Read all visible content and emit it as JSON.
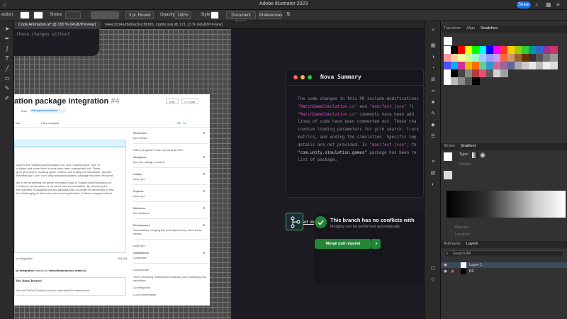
{
  "app": {
    "title": "Adobe Illustrator 2023",
    "share_label": "Share"
  },
  "control_bar": {
    "left_label": "ection",
    "stroke_label": "Stroke",
    "brush_label": "3 pt. Round",
    "opacity_label": "Opacity",
    "opacity_value": "100%",
    "style_label": "Style",
    "doc_setup": "Document Setup",
    "preferences": "Preferences"
  },
  "doc_tabs": [
    {
      "label": "Code Animation.ai* @ 150 % (RGB/Preview)"
    },
    {
      "label": "64ee3154ad6d6ad1ecf93db_Lights.svg @ 171.13 % (RGB/Preview)"
    }
  ],
  "canvas": {
    "code_snippet": "these changes without",
    "github": {
      "title_main": "ation package integration",
      "title_num": "#4",
      "from_text": "from",
      "branch_pill": "stdio/gamesimulation",
      "edit_label": "Edit",
      "code_label": "<> Code",
      "tabs": [
        "nits",
        "Files changed"
      ],
      "diffstat": "+36 −14",
      "desc_lines": [
        "nges to the \"MatchGameSimulation.cs\" and \"manifest.json\" files. In",
        "n added and some lines of code have been commented out. These",
        "g for grid search, tracking game metrics, and ending the simulation. Specific",
        "manifest.json\", the \"com.unity.simulation.games\" package has been removed",
        "",
        "ars to be an altering the game simulation logic in \"MatchGameSimulation.cs\"",
        "r enhance performance or introduce new functionalities. By removing the",
        "the manifest, it suggests that the package may no longer be necessary or has",
        "it is challenging to determine the exact implications of these changes without"
      ],
      "commit_line": "se-integration",
      "commit_hash": "f1f1c18",
      "branch_line_pre": "se-integration",
      "branch_line_mid": "branch on",
      "branch_line_target": "slimz/dotdemonico-match-a",
      "base_branch": "the base branch",
      "cli_hint": "line via GitHub Desktop or view command line instructions.",
      "sidebar": [
        {
          "label": "Reviewers",
          "value": "No reviews"
        },
        {
          "label": "",
          "value": "Still in progress? Learn about draft PRs"
        },
        {
          "label": "Assignees",
          "value": "No one—assign yourself"
        },
        {
          "label": "Labels",
          "value": "None yet"
        },
        {
          "label": "Projects",
          "value": "None yet"
        },
        {
          "label": "Milestone",
          "value": "No milestone"
        },
        {
          "label": "Development",
          "value": "Successfully merging this pull request may close these issues."
        },
        {
          "label": "",
          "value": "None yet"
        },
        {
          "label": "Notifications",
          "value": "Customize"
        },
        {
          "label": "",
          "value": "Unsubscribe"
        },
        {
          "label": "",
          "value": "You're receiving notifications because you're watching this repository."
        },
        {
          "label": "",
          "value": "2 participants"
        },
        {
          "label": "",
          "value": "Lock conversation"
        }
      ]
    },
    "nova": {
      "title": "Nova Summary",
      "lines": [
        [
          {
            "t": "The code changes in this PR include modifications"
          }
        ],
        [
          {
            "t": "\"MatchGameSimulation.cs\"",
            "c": "pk"
          },
          {
            "t": " and "
          },
          {
            "t": "\"manifest.json\"",
            "c": "pk"
          },
          {
            "t": " fi"
          }
        ],
        [
          {
            "t": "\"MatchGameSimulation.cs\"",
            "c": "pk"
          },
          {
            "t": " comments have been add"
          }
        ],
        [
          {
            "t": "lines of code have been commented out. These cha"
          }
        ],
        [
          {
            "t": "involve loading parameters for grid search, track"
          }
        ],
        [
          {
            "t": "metrics, and ending the simulation. Specific imp"
          }
        ],
        [
          {
            "t": "details are not provided. In "
          },
          {
            "t": "\"manifest.json\"",
            "c": "pk"
          },
          {
            "t": ", th"
          }
        ],
        [
          {
            "t": "\"com.unity.simulation.games\"",
            "c": "wh"
          },
          {
            "t": " package has been re"
          }
        ],
        [
          {
            "t": "list of package."
          }
        ]
      ],
      "load_more": "load more"
    },
    "merge": {
      "title": "This branch has no conflicts with",
      "subtitle": "Merging can be performed automatically.",
      "button": "Merge pull request"
    }
  },
  "panels": {
    "top_tabs": [
      "Transform",
      "Align",
      "Swatches"
    ],
    "mid_tabs": [
      "Stroke",
      "Gradient"
    ],
    "gradient_type_label": "Type:",
    "stroke_label": "Stroke:",
    "opacity_label": "Opacity:",
    "location_label": "Location:",
    "bottom_tabs": [
      "Artboards",
      "Layers"
    ],
    "search_placeholder": "Search All",
    "layers": [
      {
        "name": "Layer 1"
      },
      {
        "name": "BC"
      }
    ],
    "swatch_colors": [
      [
        "#ffffff",
        "#000000",
        "#ff0000",
        "#ffff00",
        "#00ff00",
        "#00ffff",
        "#0000ff",
        "#ff00ff",
        "#ff3333",
        "#ffcc00",
        "#99cc00",
        "#33cc33",
        "#009999",
        "#3366cc",
        "#993399",
        "#cc3366"
      ],
      [
        "#ff9999",
        "#ffcc99",
        "#ffff99",
        "#ccff99",
        "#99ffcc",
        "#99ccff",
        "#9999ff",
        "#cc99ff",
        "#ff6633",
        "#cc9966",
        "#996633",
        "#663300",
        "#333333",
        "#555555",
        "#777777",
        "#999999"
      ],
      [
        "#4d4dff",
        "#00aaff",
        "#cc3399",
        "#e6b800",
        "#ff6f00",
        "#66cc99",
        "#3399cc",
        "#cc6699",
        "#996699",
        "#666699",
        "#aaaaaa",
        "#cccccc",
        "#e6e6e6",
        "#bbbbbb",
        "#eeeeee",
        "#dddddd"
      ],
      [
        "#ffffff",
        "#000000",
        "#444444",
        "#888888",
        "#b33a3a",
        "#e94e77",
        "#5c5c5c",
        "#d4d4d4",
        "#a0a0a0"
      ],
      [
        "#ffffff",
        "#bbbbbb",
        "#888888",
        "#555555",
        "#000000"
      ]
    ]
  }
}
